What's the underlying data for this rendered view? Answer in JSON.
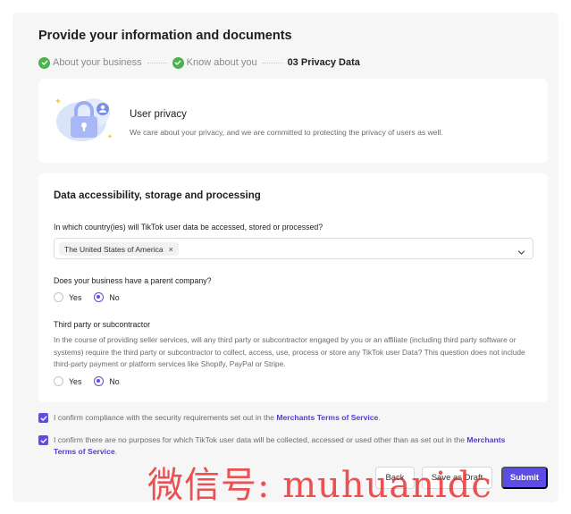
{
  "page": {
    "title": "Provide your information and documents"
  },
  "stepper": {
    "steps": [
      {
        "label": "About your business",
        "status": "done"
      },
      {
        "label": "Know about you",
        "status": "done"
      },
      {
        "label": "03 Privacy Data",
        "status": "active"
      }
    ]
  },
  "privacy_card": {
    "title": "User privacy",
    "description": "We care about your privacy, and we are committed to protecting the privacy of users as well."
  },
  "data_section": {
    "title": "Data accessibility, storage and processing",
    "country_question": "In which country(ies) will TikTok user data be accessed, stored or processed?",
    "country_selected": "The United States of America",
    "chip_remove": "×",
    "parent_question": "Does your business have a parent company?",
    "parent_options": {
      "yes": "Yes",
      "no": "No",
      "selected": "No"
    },
    "third_party_title": "Third party or subcontractor",
    "third_party_desc": "In the course of providing seller services, will any third party or subcontractor engaged by you or an affiliate (including third party software or systems) require the third party or subcontractor to collect, access, use, process or store any TikTok user Data? This question does not include third-party payment or platform services like Shopify, PayPal or Stripe.",
    "third_party_options": {
      "yes": "Yes",
      "no": "No",
      "selected": "No"
    }
  },
  "confirmations": [
    {
      "text": "I confirm compliance with the security requirements set out in the ",
      "link": "Merchants Terms of Service",
      "tail": ".",
      "checked": true
    },
    {
      "text": "I confirm there are no purposes for which TikTok user data will be collected, accessed or used other than as set out in the ",
      "link": "Merchants Terms of Service",
      "tail": ".",
      "checked": true
    }
  ],
  "actions": {
    "back": "Back",
    "save_draft": "Save as Draft",
    "submit": "Submit"
  },
  "watermark": "微信号: muhuanidc",
  "colors": {
    "accent": "#5b4de6",
    "success": "#4bb34b",
    "link": "#4f3fd1"
  }
}
